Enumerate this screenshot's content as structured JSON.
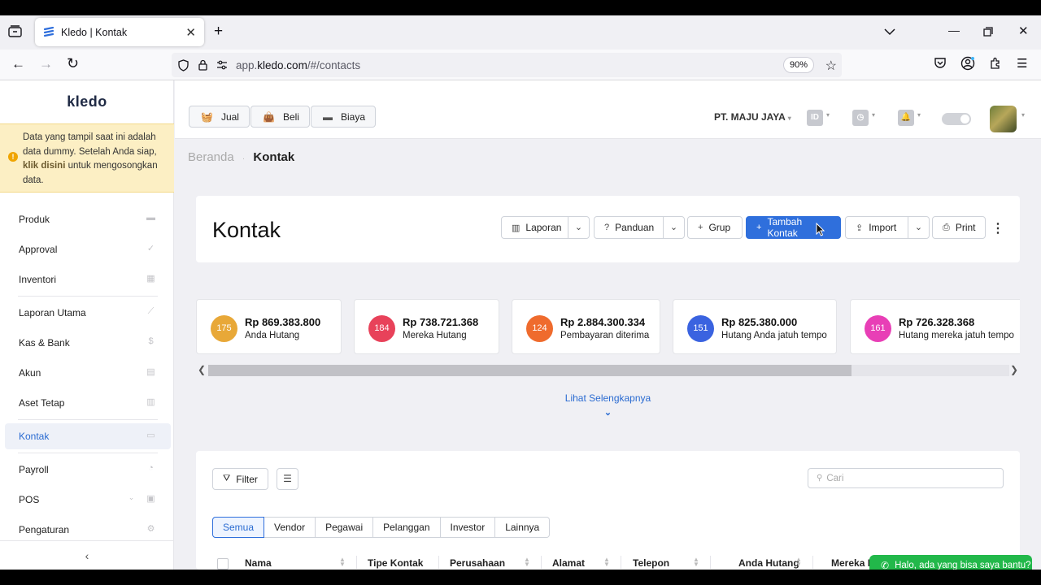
{
  "browser": {
    "tab_title": "Kledo | Kontak",
    "url_prefix": "app.",
    "url_domain": "kledo.com",
    "url_path": "/#/contacts",
    "zoom": "90%"
  },
  "sidebar": {
    "logo": "kledo",
    "notice_line1": "Data yang tampil saat ini adalah data dummy. Setelah Anda siap,",
    "notice_link": "klik disini",
    "notice_line2": "untuk mengosongkan data.",
    "items": [
      {
        "label": "Produk",
        "icon": "box-icon"
      },
      {
        "label": "Approval",
        "icon": "check-icon"
      },
      {
        "label": "Inventori",
        "icon": "building-icon"
      },
      {
        "label": "Laporan Utama",
        "icon": "chart-icon"
      },
      {
        "label": "Kas & Bank",
        "icon": "dollar-icon"
      },
      {
        "label": "Akun",
        "icon": "table-icon"
      },
      {
        "label": "Aset Tetap",
        "icon": "building-icon"
      },
      {
        "label": "Kontak",
        "icon": "contact-card-icon"
      },
      {
        "label": "Payroll",
        "icon": "check-circle-icon"
      },
      {
        "label": "POS",
        "icon": "pos-icon"
      },
      {
        "label": "Pengaturan",
        "icon": "gears-icon"
      }
    ]
  },
  "topbar": {
    "jual": "Jual",
    "beli": "Beli",
    "biaya": "Biaya",
    "company": "PT. MAJU JAYA",
    "lang": "ID"
  },
  "breadcrumb": {
    "home": "Beranda",
    "current": "Kontak"
  },
  "page": {
    "title": "Kontak",
    "buttons": {
      "laporan": "Laporan",
      "panduan": "Panduan",
      "grup": "Grup",
      "tambah": "Tambah Kontak",
      "import": "Import",
      "print": "Print"
    }
  },
  "stats": [
    {
      "count": "175",
      "amount": "Rp 869.383.800",
      "label": "Anda Hutang",
      "color": "#e8a838"
    },
    {
      "count": "184",
      "amount": "Rp 738.721.368",
      "label": "Mereka Hutang",
      "color": "#e8425a"
    },
    {
      "count": "124",
      "amount": "Rp 2.884.300.334",
      "label": "Pembayaran diterima",
      "color": "#ef6b2d"
    },
    {
      "count": "151",
      "amount": "Rp 825.380.000",
      "label": "Hutang Anda jatuh tempo",
      "color": "#3a63e0"
    },
    {
      "count": "161",
      "amount": "Rp 726.328.368",
      "label": "Hutang mereka jatuh tempo",
      "color": "#e83fb6"
    }
  ],
  "more_link": "Lihat Selengkapnya",
  "table": {
    "filter": "Filter",
    "search_placeholder": "Cari",
    "tabs": [
      "Semua",
      "Vendor",
      "Pegawai",
      "Pelanggan",
      "Investor",
      "Lainnya"
    ],
    "columns": [
      "Nama",
      "Tipe Kontak",
      "Perusahaan",
      "Alamat",
      "Telepon",
      "Anda Hutang",
      "Mereka H"
    ]
  },
  "chat": "Halo, ada yang bisa saya bantu?"
}
